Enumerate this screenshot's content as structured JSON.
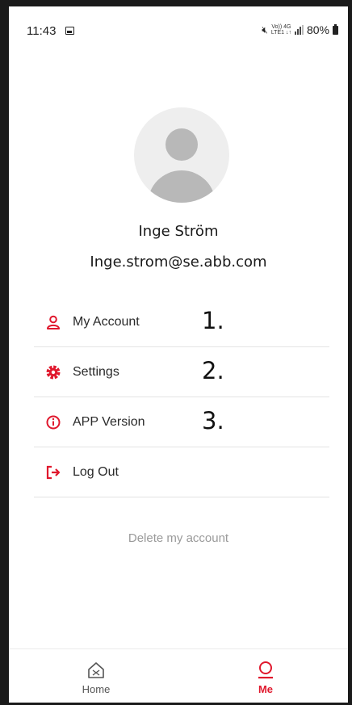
{
  "status_bar": {
    "time": "11:43",
    "network_top": "Vo)) 4G",
    "network_bottom": "LTE1 ↓↑",
    "battery": "80%"
  },
  "profile": {
    "name": "Inge Ström",
    "email": "Inge.strom@se.abb.com"
  },
  "menu": {
    "items": [
      {
        "label": "My Account",
        "icon": "user-icon",
        "annotation": "1."
      },
      {
        "label": "Settings",
        "icon": "gear-icon",
        "annotation": "2."
      },
      {
        "label": "APP Version",
        "icon": "info-icon",
        "annotation": "3."
      },
      {
        "label": "Log Out",
        "icon": "logout-icon",
        "annotation": ""
      }
    ]
  },
  "delete_account": "Delete my account",
  "bottom_nav": {
    "tabs": [
      {
        "label": "Home",
        "icon": "home-icon",
        "active": false
      },
      {
        "label": "Me",
        "icon": "profile-icon",
        "active": true
      }
    ]
  },
  "colors": {
    "accent": "#e0182d",
    "text": "#2a2a2a",
    "muted": "#9a9a9a",
    "divider": "#e3e3e3"
  }
}
